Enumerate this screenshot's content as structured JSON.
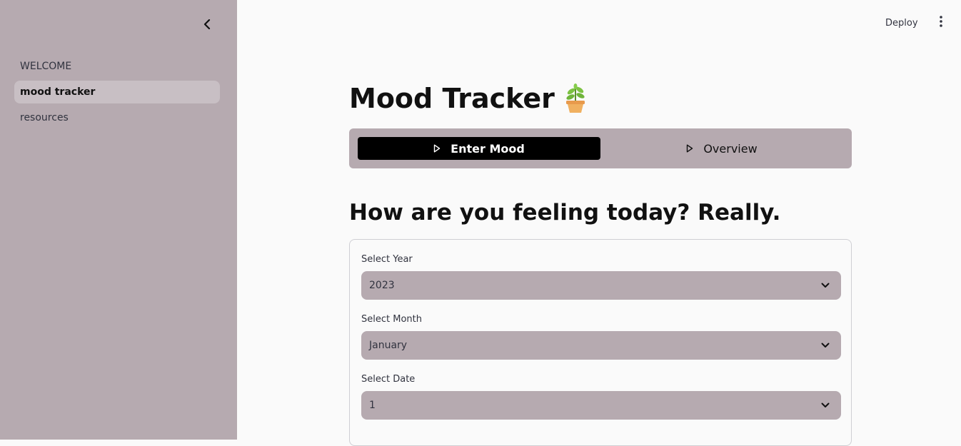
{
  "sidebar": {
    "collapse_icon": "chevron-left-icon",
    "items": [
      {
        "label": "WELCOME",
        "active": false
      },
      {
        "label": "mood tracker",
        "active": true
      },
      {
        "label": "resources",
        "active": false
      }
    ]
  },
  "topbar": {
    "deploy_label": "Deploy",
    "menu_icon": "kebab-menu-icon"
  },
  "main": {
    "title": "Mood Tracker",
    "title_icon": "potted-plant-icon",
    "tabs": [
      {
        "label": "Enter Mood",
        "icon": "play-triangle-icon",
        "selected": true
      },
      {
        "label": "Overview",
        "icon": "play-triangle-icon",
        "selected": false
      }
    ],
    "heading": "How are you feeling today? Really.",
    "form": {
      "year": {
        "label": "Select Year",
        "value": "2023"
      },
      "month": {
        "label": "Select Month",
        "value": "January"
      },
      "date": {
        "label": "Select Date",
        "value": "1"
      }
    }
  },
  "colors": {
    "sidebar_bg": "#b6aab0",
    "main_bg": "#fafafa",
    "active_tab_bg": "#000000",
    "select_bg": "#b6aab0"
  }
}
